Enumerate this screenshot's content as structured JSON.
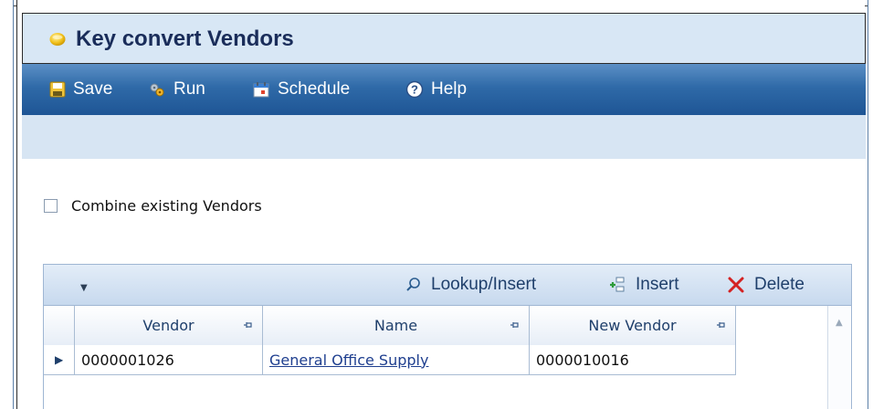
{
  "window": {
    "title": "Key convert Vendors",
    "title_icon": "yellow-circle-icon"
  },
  "toolbar": {
    "items": [
      {
        "label": "Save",
        "icon": "save-icon"
      },
      {
        "label": "Run",
        "icon": "gears-icon"
      },
      {
        "label": "Schedule",
        "icon": "calendar-icon"
      },
      {
        "label": "Help",
        "icon": "help-icon"
      }
    ]
  },
  "options": {
    "combine_label": "Combine existing Vendors",
    "combine_checked": false
  },
  "grid": {
    "toolbar": {
      "lookup_insert": "Lookup/Insert",
      "insert": "Insert",
      "delete": "Delete"
    },
    "columns": [
      "Vendor",
      "Name",
      "New Vendor"
    ],
    "rows": [
      {
        "vendor": "0000001026",
        "name": "General Office Supply",
        "new_vendor": "0000010016"
      }
    ]
  },
  "colors": {
    "toolbar_bg": "#2f6aa8",
    "title_bg": "#d8e7f5",
    "accent_text": "#1f3f6b"
  }
}
